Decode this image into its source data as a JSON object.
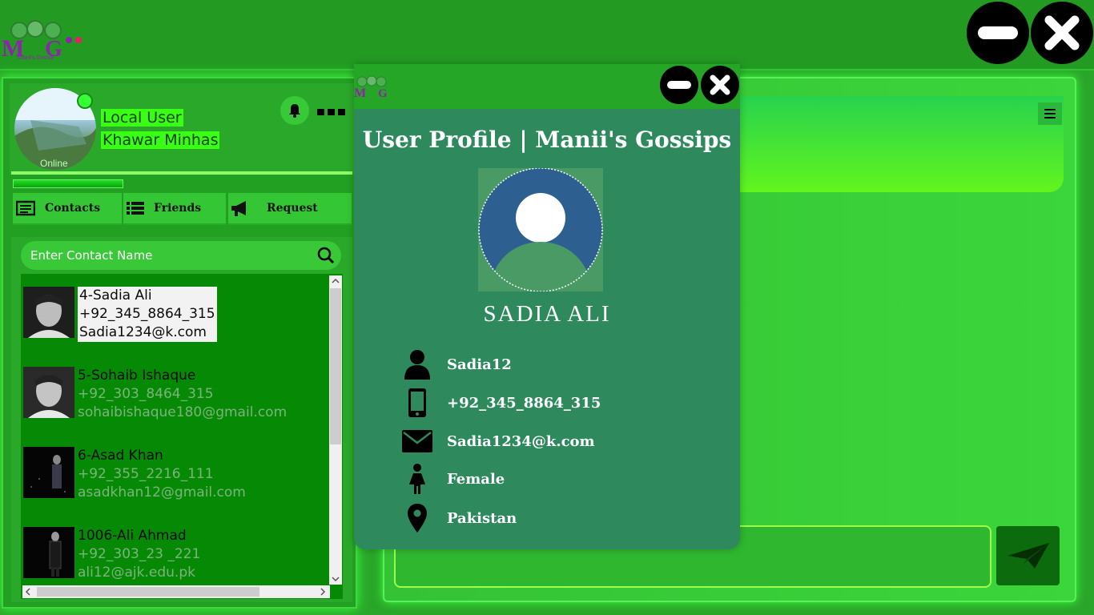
{
  "app": {
    "logo_text": "M G",
    "logo_sub": "Manii's Gossip"
  },
  "user": {
    "line1": "Local User",
    "line2": "Khawar Minhas",
    "status": "Online"
  },
  "tabs": [
    {
      "label": "Contacts",
      "icon": "contacts-card-icon"
    },
    {
      "label": "Friends",
      "icon": "list-icon"
    },
    {
      "label": "Request",
      "icon": "megaphone-icon"
    }
  ],
  "search": {
    "placeholder": "Enter Contact Name"
  },
  "contacts": [
    {
      "name": "4-Sadia Ali",
      "phone": "+92_345_8864_315",
      "email": "Sadia1234@k.com",
      "selected": true
    },
    {
      "name": "5-Sohaib  Ishaque",
      "phone": "+92_303_8464_315",
      "email": "sohaibishaque180@gmail.com"
    },
    {
      "name": "6-Asad Khan",
      "phone": "+92_355_2216_111",
      "email": "asadkhan12@gmail.com"
    },
    {
      "name": "1006-Ali Ahmad",
      "phone": "+92_303_23 _221",
      "email": "ali12@ajk.edu.pk"
    }
  ],
  "dialog": {
    "title": "User Profile | Manii's Gossips",
    "name": "SADIA  ALI",
    "rows": [
      {
        "icon": "user-icon",
        "value": "Sadia12"
      },
      {
        "icon": "mobile-phone-icon",
        "value": "+92_345_8864_315"
      },
      {
        "icon": "envelope-icon",
        "value": "Sadia1234@k.com"
      },
      {
        "icon": "female-icon",
        "value": "Female"
      },
      {
        "icon": "location-pin-icon",
        "value": "Pakistan"
      }
    ]
  },
  "colors": {
    "accent": "#39ff14",
    "dialog_bg": "#2e8a5c",
    "panel": "#22a022"
  }
}
